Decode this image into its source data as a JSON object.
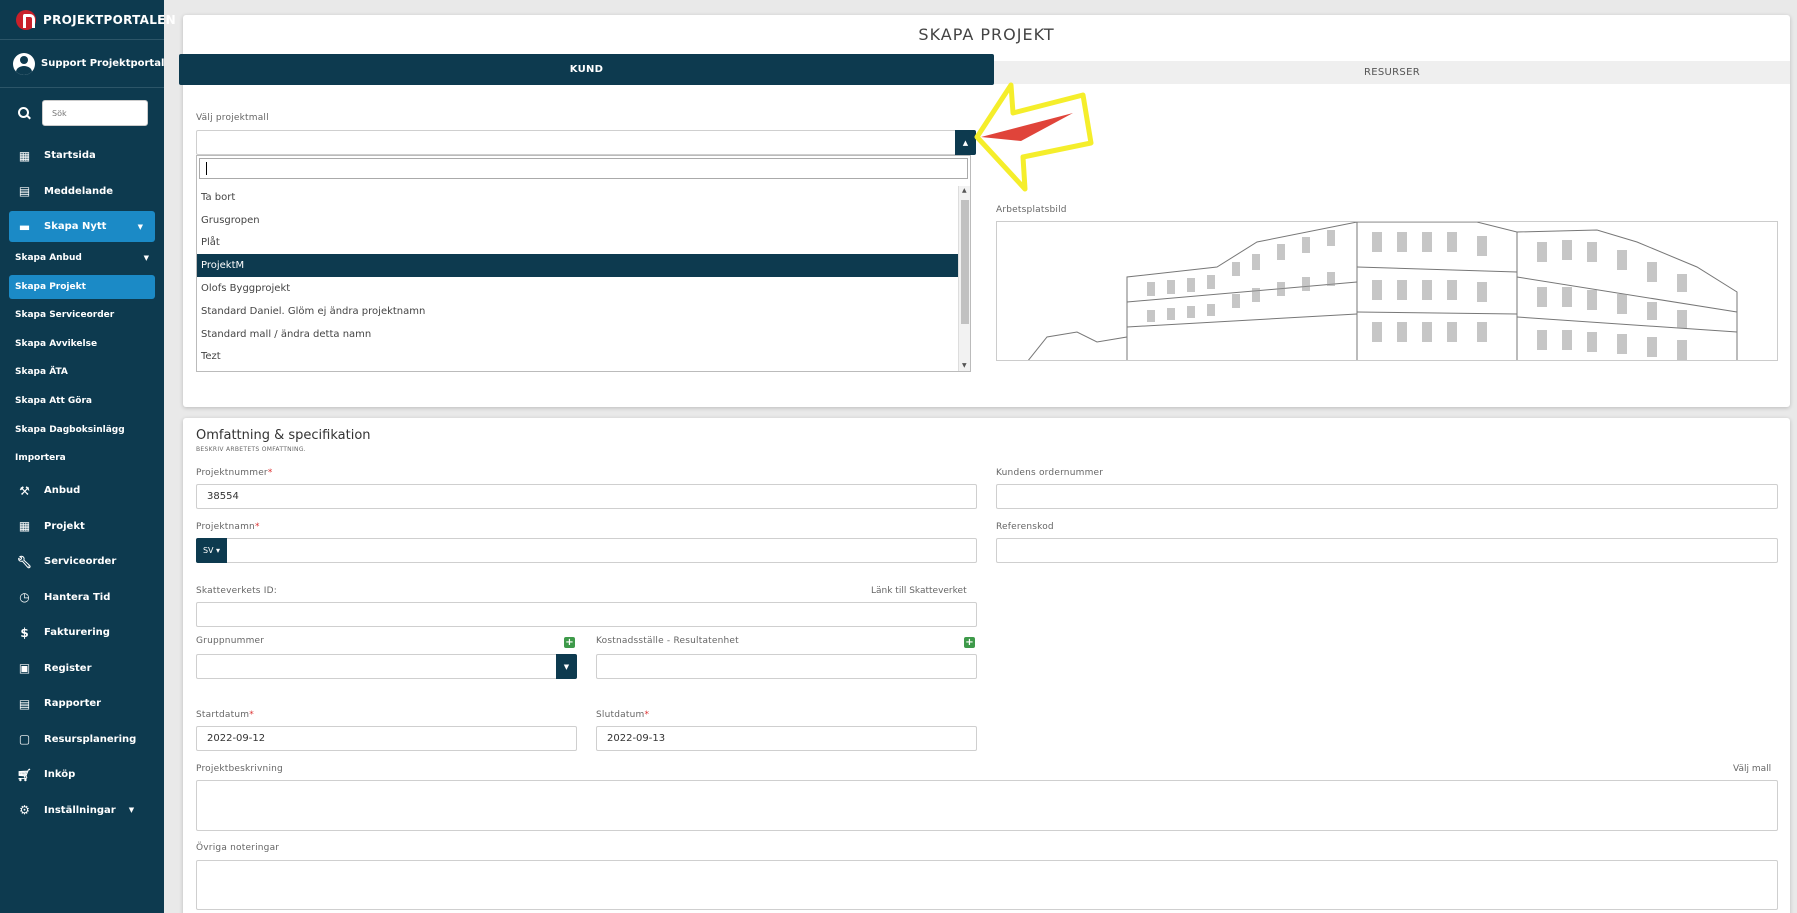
{
  "sidebar": {
    "brand": "PROJEKTPORTALEN",
    "user": "Support Projektportalen",
    "search_placeholder": "Sök",
    "items_top": [
      {
        "label": "Startsida",
        "icon": "dashboard-icon"
      },
      {
        "label": "Meddelande",
        "icon": "message-icon"
      },
      {
        "label": "Skapa Nytt",
        "icon": "add-box-icon"
      }
    ],
    "subitems": [
      "Skapa Anbud",
      "Skapa Projekt",
      "Skapa Serviceorder",
      "Skapa Avvikelse",
      "Skapa ÄTA",
      "Skapa Att Göra",
      "Skapa Dagboksinlägg",
      "Importera"
    ],
    "items_bottom": [
      {
        "label": "Anbud",
        "icon": "gavel-icon"
      },
      {
        "label": "Projekt",
        "icon": "projects-icon"
      },
      {
        "label": "Serviceorder",
        "icon": "wrench-icon"
      },
      {
        "label": "Hantera Tid",
        "icon": "clock-icon"
      },
      {
        "label": "Fakturering",
        "icon": "dollar-icon"
      },
      {
        "label": "Register",
        "icon": "register-icon"
      },
      {
        "label": "Rapporter",
        "icon": "calendar-icon"
      },
      {
        "label": "Resursplanering",
        "icon": "calendar-blank-icon"
      },
      {
        "label": "Inköp",
        "icon": "cart-icon"
      },
      {
        "label": "Inställningar",
        "icon": "gear-icon"
      }
    ]
  },
  "page": {
    "title": "SKAPA PROJEKT",
    "tabs": [
      "KUND",
      "RESURSER"
    ]
  },
  "template": {
    "label": "Välj projektmall",
    "options": [
      "Ta bort",
      "Grusgropen",
      "Plåt",
      "ProjektM",
      "Olofs Byggprojekt",
      "Standard Daniel. Glöm ej ändra projektnamn",
      "Standard mall / ändra detta namn",
      "Tezt"
    ],
    "selected_index": 3
  },
  "site_image_label": "Arbetsplatsbild",
  "scope": {
    "title": "Omfattning & specifikation",
    "subtitle": "BESKRIV ARBETETS OMFATTNING.",
    "project_number_label": "Projektnummer",
    "project_number": "38554",
    "customer_order_label": "Kundens ordernummer",
    "project_name_label": "Projektnamn",
    "lang": "SV",
    "reference_label": "Referenskod",
    "tax_id_label": "Skatteverkets ID:",
    "tax_link": "Länk till Skatteverket",
    "group_label": "Gruppnummer",
    "cost_center_label": "Kostnadsställe - Resultatenhet",
    "start_label": "Startdatum",
    "start_value": "2022-09-12",
    "end_label": "Slutdatum",
    "end_value": "2022-09-13",
    "description_label": "Projektbeskrivning",
    "choose_template": "Välj mall",
    "notes_label": "Övriga noteringar"
  },
  "colors": {
    "sidebar": "#0d3a4f",
    "active": "#1b8ac6",
    "accent_green": "#3e9a4a",
    "annotation_yellow": "#f5ee2b",
    "annotation_red": "#e0443a"
  }
}
